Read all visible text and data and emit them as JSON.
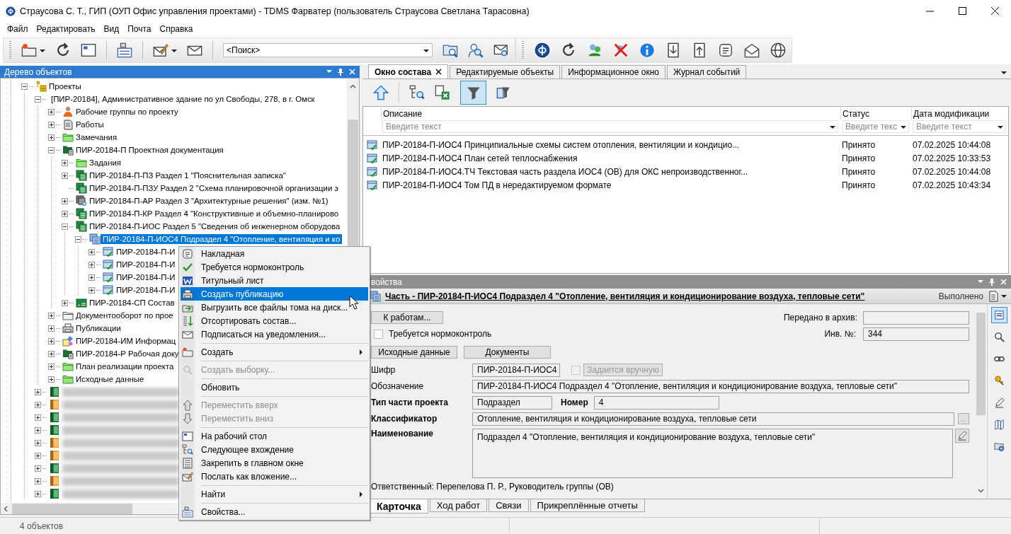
{
  "window": {
    "title": "Страусова С. Т., ГИП (ОУП Офис управления проектами) - TDMS Фарватер (пользователь Страусова Светлана Тарасовна)"
  },
  "menu": [
    "Файл",
    "Редактировать",
    "Вид",
    "Почта",
    "Справка"
  ],
  "toolbar": {
    "search": {
      "value": "<Поиск>"
    }
  },
  "tree_panel": {
    "title": "Дерево объектов",
    "items": [
      {
        "kind": "projects",
        "label": "Проекты",
        "expanded": true,
        "selected": false,
        "children": [
          {
            "kind": "project",
            "label": "[ПИР-20184], Административное здание по ул Свободы, 278, в г. Омск",
            "expanded": true,
            "selected": false,
            "children": [
              {
                "kind": "team",
                "label": "Рабочие группы по проекту",
                "expanded": false,
                "selected": false
              },
              {
                "kind": "works",
                "label": "Работы",
                "expanded": false,
                "selected": false
              },
              {
                "kind": "folder",
                "label": "Замечания",
                "expanded": false,
                "selected": false
              },
              {
                "kind": "docset",
                "label": "ПИР-20184-П Проектная документация",
                "expanded": true,
                "selected": false,
                "children": [
                  {
                    "kind": "folder",
                    "label": "Задания",
                    "expanded": false,
                    "selected": false
                  },
                  {
                    "kind": "section",
                    "label": "ПИР-20184-П-ПЗ Раздел 1 \"Пояснительная записка\"",
                    "expanded": false,
                    "selected": false
                  },
                  {
                    "kind": "section",
                    "label": "ПИР-20184-П-ПЗУ Раздел 2 \"Схема планировочной организации з",
                    "selected": false,
                    "leaf": true
                  },
                  {
                    "kind": "review",
                    "label": "ПИР-20184-П-АР Раздел 3 \"Архитектурные решения\" (изм. №1)",
                    "expanded": false,
                    "selected": false
                  },
                  {
                    "kind": "section",
                    "label": "ПИР-20184-П-КР Раздел 4 \"Конструктивные и объемно-планирово",
                    "expanded": false,
                    "selected": false
                  },
                  {
                    "kind": "section",
                    "label": "ПИР-20184-П-ИОС Раздел 5 \"Сведения об инженерном оборудова",
                    "expanded": true,
                    "selected": false,
                    "children": [
                      {
                        "kind": "subsection",
                        "label": "ПИР-20184-П-ИОС4 Подраздел 4 \"Отопление, вентиляция и ко",
                        "expanded": true,
                        "selected": true,
                        "children": [
                          {
                            "kind": "volume",
                            "label": "ПИР-20184-П-И",
                            "expanded": false,
                            "selected": false
                          },
                          {
                            "kind": "volume",
                            "label": "ПИР-20184-П-И",
                            "expanded": false,
                            "selected": false
                          },
                          {
                            "kind": "volume",
                            "label": "ПИР-20184-П-И",
                            "expanded": false,
                            "selected": false
                          },
                          {
                            "kind": "volume",
                            "label": "ПИР-20184-П-И",
                            "expanded": false,
                            "selected": false
                          }
                        ]
                      }
                    ]
                  },
                  {
                    "kind": "spec",
                    "label": "ПИР-20184-СП Состав",
                    "expanded": false,
                    "selected": false
                  }
                ]
              },
              {
                "kind": "docflow",
                "label": "Документооборот по прое",
                "expanded": false,
                "selected": false
              },
              {
                "kind": "publications",
                "label": "Публикации",
                "expanded": false,
                "selected": false
              },
              {
                "kind": "model",
                "label": "ПИР-20184-ИМ Информац",
                "expanded": false,
                "selected": false
              },
              {
                "kind": "docset",
                "label": "ПИР-20184-Р Рабочая доку",
                "expanded": false,
                "selected": false
              },
              {
                "kind": "folder",
                "label": "План реализации проекта",
                "expanded": false,
                "selected": false
              },
              {
                "kind": "folder",
                "label": "Исходные данные",
                "expanded": false,
                "selected": false
              }
            ]
          },
          {
            "kind": "hidden",
            "color": "#1a8a3a",
            "expanded": false,
            "selected": false
          },
          {
            "kind": "hidden",
            "color": "#f5a030",
            "expanded": false,
            "selected": false
          },
          {
            "kind": "hidden",
            "color": "#1a8a3a",
            "expanded": false,
            "selected": false
          },
          {
            "kind": "hidden",
            "color": "#1a8a3a",
            "expanded": false,
            "selected": false
          },
          {
            "kind": "hidden",
            "color": "#f5a030",
            "expanded": false,
            "selected": false
          },
          {
            "kind": "hidden",
            "color": "#f5a030",
            "expanded": false,
            "selected": false
          },
          {
            "kind": "hidden",
            "color": "#1a8a3a",
            "expanded": false,
            "selected": false
          },
          {
            "kind": "hidden",
            "color": "#f5a030",
            "expanded": false,
            "selected": false
          },
          {
            "kind": "hidden",
            "color": "#1a8a3a",
            "expanded": false,
            "selected": false
          }
        ]
      }
    ]
  },
  "context_menu": {
    "items": [
      {
        "kind": "item",
        "label": "Накладная",
        "disabled": false,
        "selected": false,
        "submenu": false
      },
      {
        "kind": "item",
        "label": "Требуется нормоконтроль",
        "disabled": false,
        "selected": false,
        "submenu": false
      },
      {
        "kind": "item",
        "label": "Титульный лист",
        "disabled": false,
        "selected": false,
        "submenu": false
      },
      {
        "kind": "item",
        "label": "Создать публикацию",
        "disabled": false,
        "selected": true,
        "submenu": false
      },
      {
        "kind": "item",
        "label": "Выгрузить все файлы тома на диск...",
        "disabled": false,
        "selected": false,
        "submenu": false
      },
      {
        "kind": "item",
        "label": "Отсортировать состав...",
        "disabled": false,
        "selected": false,
        "submenu": false
      },
      {
        "kind": "item",
        "label": "Подписаться на уведомления...",
        "disabled": false,
        "selected": false,
        "submenu": false
      },
      {
        "kind": "separator"
      },
      {
        "kind": "item",
        "label": "Создать",
        "disabled": false,
        "selected": false,
        "submenu": true
      },
      {
        "kind": "separator"
      },
      {
        "kind": "item",
        "label": "Создать выборку...",
        "disabled": true,
        "selected": false,
        "submenu": false
      },
      {
        "kind": "separator"
      },
      {
        "kind": "item",
        "label": "Обновить",
        "disabled": false,
        "selected": false,
        "submenu": false
      },
      {
        "kind": "separator"
      },
      {
        "kind": "item",
        "label": "Переместить вверх",
        "disabled": true,
        "selected": false,
        "submenu": false
      },
      {
        "kind": "item",
        "label": "Переместить вниз",
        "disabled": true,
        "selected": false,
        "submenu": false
      },
      {
        "kind": "separator"
      },
      {
        "kind": "item",
        "label": "На рабочий стол",
        "disabled": false,
        "selected": false,
        "submenu": false
      },
      {
        "kind": "item",
        "label": "Следующее вхождение",
        "disabled": false,
        "selected": false,
        "submenu": false
      },
      {
        "kind": "item",
        "label": "Закрепить в главном окне",
        "disabled": false,
        "selected": false,
        "submenu": false
      },
      {
        "kind": "item",
        "label": "Послать как вложение...",
        "disabled": false,
        "selected": false,
        "submenu": false
      },
      {
        "kind": "separator"
      },
      {
        "kind": "item",
        "label": "Найти",
        "disabled": false,
        "selected": false,
        "submenu": true
      },
      {
        "kind": "separator"
      },
      {
        "kind": "item",
        "label": "Свойства...",
        "disabled": false,
        "selected": false,
        "submenu": false
      }
    ]
  },
  "composition_panel": {
    "tabs": [
      {
        "label": "Окно состава",
        "selected": true,
        "closable": true
      },
      {
        "label": "Редактируемые объекты",
        "selected": false,
        "closable": false
      },
      {
        "label": "Информационное окно",
        "selected": false,
        "closable": false
      },
      {
        "label": "Журнал событий",
        "selected": false,
        "closable": false
      }
    ],
    "filter_active": true,
    "table": {
      "columns": [
        {
          "title": "Описание",
          "placeholder": "Введите текст"
        },
        {
          "title": "Статус",
          "placeholder": "Введите текс"
        },
        {
          "title": "Дата модификации",
          "placeholder": "Введите текст"
        }
      ],
      "rows": [
        {
          "description": "ПИР-20184-П-ИОС4 Принципиальные схемы систем отопления, вентиляции и кондицио...",
          "status": "Принято",
          "modified": "07.02.2025 10:44:08"
        },
        {
          "description": "ПИР-20184-П-ИОС4 План сетей теплоснабжения",
          "status": "Принято",
          "modified": "07.02.2025 10:33:53"
        },
        {
          "description": "ПИР-20184-П-ИОС4.ТЧ Текстовая часть раздела ИОС4 (ОВ) для ОКС непроизводственног...",
          "status": "Принято",
          "modified": "07.02.2025 10:44:08"
        },
        {
          "description": "ПИР-20184-П-ИОС4 Том ПД в нередактируемом формате",
          "status": "Принято",
          "modified": "07.02.2025 10:43:34"
        }
      ]
    }
  },
  "properties_panel": {
    "title": "войства",
    "object_title": "Часть - ПИР-20184-П-ИОС4 Подраздел 4 \"Отопление, вентиляция и кондиционирование воздуха, тепловые сети\"",
    "state": "Выполнено",
    "form": {
      "to_works_button": "К работам...",
      "archive": {
        "label": "Передано в архив:"
      },
      "normcontrol": {
        "label": "Требуется нормоконтроль",
        "checked": false
      },
      "inventory": {
        "label": "Инв. №:",
        "value": "344"
      },
      "buttons": [
        "Исходные данные",
        "Документы"
      ],
      "cipher": {
        "label": "Шифр",
        "value": "ПИР-20184-П-ИОС4",
        "required": false
      },
      "manual": {
        "label": "Задается вручную",
        "checked": false,
        "disabled": true
      },
      "designation": {
        "label": "Обозначение",
        "value": "ПИР-20184-П-ИОС4 Подраздел 4 \"Отопление, вентиляция и кондиционирование воздуха, тепловые сети\"",
        "required": false
      },
      "part_type": {
        "label": "Тип части проекта",
        "value": "Подраздел",
        "required": true
      },
      "number": {
        "label": "Номер",
        "value": "4",
        "required": true
      },
      "classifier": {
        "label": "Классификатор",
        "value": "Отопление, вентиляция и кондиционирование воздуха, тепловые сети",
        "required": true,
        "browse_button": "..."
      },
      "name": {
        "label": "Наименование",
        "value": "Подраздел 4 \"Отопление, вентиляция и кондиционирование воздуха, тепловые сети\"",
        "required": true
      },
      "responsible": "Ответственный: Перепелова П. Р., Руководитель группы (ОВ)"
    },
    "side_tools": [
      {
        "selected": true
      },
      {
        "selected": false
      },
      {
        "selected": false
      },
      {
        "selected": false
      },
      {
        "selected": false
      },
      {
        "selected": false
      },
      {
        "selected": false
      }
    ],
    "tabs": [
      {
        "label": "Карточка",
        "selected": true
      },
      {
        "label": "Ход работ",
        "selected": false
      },
      {
        "label": "Связи",
        "selected": false
      },
      {
        "label": "Прикреплённые отчеты",
        "selected": false
      }
    ]
  },
  "status_bar": {
    "text": "4 объектов"
  }
}
